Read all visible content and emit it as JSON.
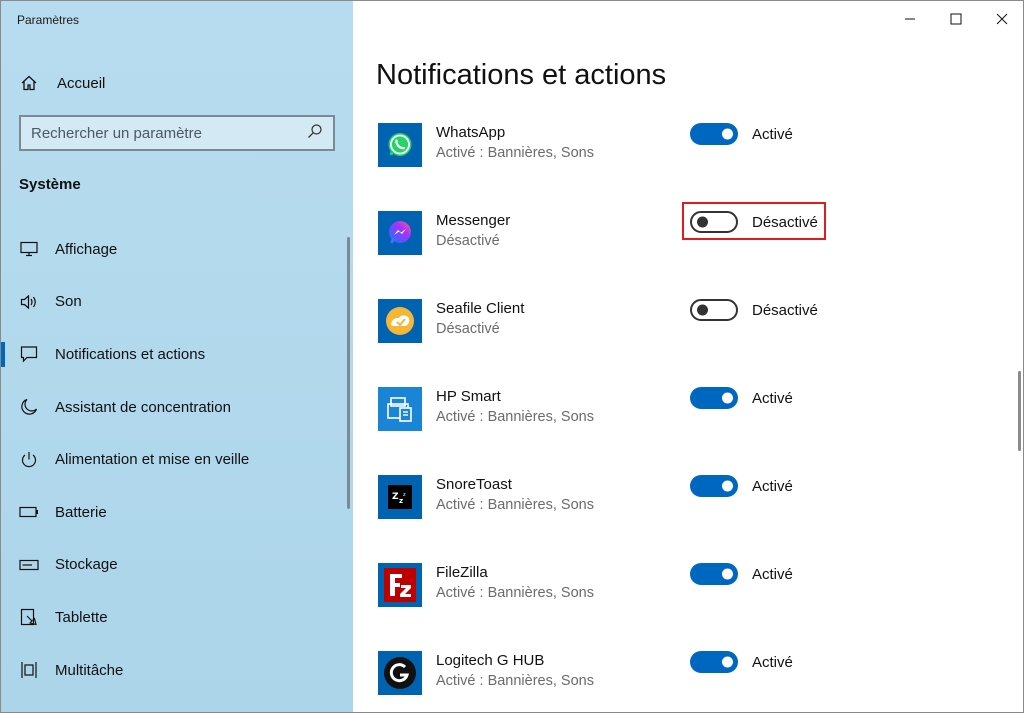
{
  "window": {
    "title": "Paramètres"
  },
  "sidebar": {
    "home_label": "Accueil",
    "search_placeholder": "Rechercher un paramètre",
    "section_title": "Système",
    "items": [
      {
        "label": "Affichage",
        "icon": "monitor-icon"
      },
      {
        "label": "Son",
        "icon": "speaker-icon"
      },
      {
        "label": "Notifications et actions",
        "icon": "notification-icon",
        "active": true
      },
      {
        "label": "Assistant de concentration",
        "icon": "moon-icon"
      },
      {
        "label": "Alimentation et mise en veille",
        "icon": "power-icon"
      },
      {
        "label": "Batterie",
        "icon": "battery-icon"
      },
      {
        "label": "Stockage",
        "icon": "storage-icon"
      },
      {
        "label": "Tablette",
        "icon": "tablet-icon"
      },
      {
        "label": "Multitâche",
        "icon": "multitask-icon"
      }
    ]
  },
  "main": {
    "title": "Notifications et actions",
    "apps": [
      {
        "name": "WhatsApp",
        "status": "Activé : Bannières, Sons",
        "toggle": "on",
        "toggle_label": "Activé",
        "icon": "whatsapp-icon",
        "color": "#0063b1"
      },
      {
        "name": "Messenger",
        "status": "Désactivé",
        "toggle": "off",
        "toggle_label": "Désactivé",
        "icon": "messenger-icon",
        "color": "#0063b1"
      },
      {
        "name": "Seafile Client",
        "status": "Désactivé",
        "toggle": "off",
        "toggle_label": "Désactivé",
        "icon": "seafile-icon",
        "color": "#0063b1"
      },
      {
        "name": "HP Smart",
        "status": "Activé : Bannières, Sons",
        "toggle": "on",
        "toggle_label": "Activé",
        "icon": "hp-smart-icon",
        "color": "#0063b1"
      },
      {
        "name": "SnoreToast",
        "status": "Activé : Bannières, Sons",
        "toggle": "on",
        "toggle_label": "Activé",
        "icon": "snoretoast-icon",
        "color": "#0063b1"
      },
      {
        "name": "FileZilla",
        "status": "Activé : Bannières, Sons",
        "toggle": "on",
        "toggle_label": "Activé",
        "icon": "filezilla-icon",
        "color": "#0063b1"
      },
      {
        "name": "Logitech G HUB",
        "status": "Activé : Bannières, Sons",
        "toggle": "on",
        "toggle_label": "Activé",
        "icon": "logitech-icon",
        "color": "#0063b1"
      }
    ]
  },
  "colors": {
    "accent": "#0067c0",
    "sidebar_bg": "#b6dbee",
    "highlight": "#e01d1d"
  }
}
